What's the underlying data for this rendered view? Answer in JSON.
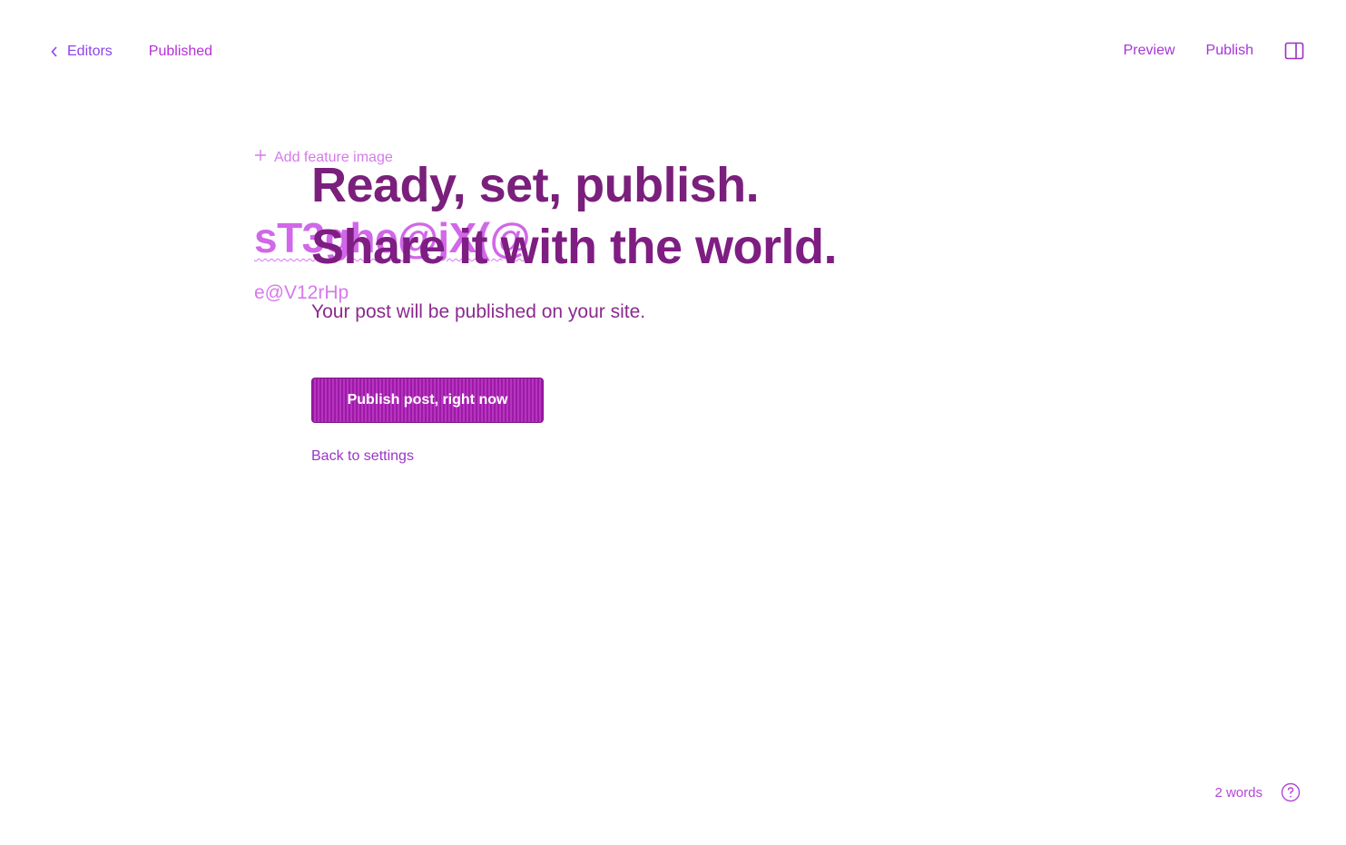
{
  "header": {
    "back_label": "Editors",
    "status": "Published",
    "preview_label": "Preview",
    "publish_label": "Publish"
  },
  "editor": {
    "feature_image_label": "Add feature image",
    "title": "sT3ghe@jX(@",
    "body": "e@V12rHp"
  },
  "publish_flow": {
    "headline_line1": "Ready, set, publish.",
    "headline_line2": "Share it with the world.",
    "subline": "Your post will be published on your site.",
    "confirm_button": "Publish post, right now",
    "back_link": "Back to settings"
  },
  "footer": {
    "word_count": "2 words"
  },
  "icons": {
    "back": "chevron-left-icon",
    "sidebar": "sidebar-toggle-icon",
    "feature_image": "plus-icon",
    "help": "help-icon"
  },
  "colors": {
    "accent": "#8e42ee",
    "primary_button": "#a023aa",
    "headline": "#7a1f7c"
  }
}
